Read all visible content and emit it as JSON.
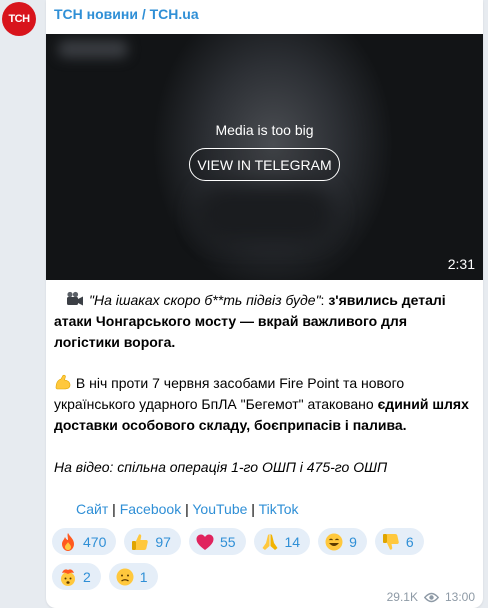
{
  "channel": {
    "avatar_text": "ТСН",
    "name": "ТСН новини / TCH.ua"
  },
  "media": {
    "note": "Media is too big",
    "button_label": "VIEW IN TELEGRAM",
    "duration": "2:31"
  },
  "post": {
    "p1_italic": "\"На ішаках скоро б**ть підвіз буде\"",
    "p1_colon": ": ",
    "p1_bold": "з'явились деталі атаки Чонгарського мосту — вкрай важливого для логістики ворога.",
    "p2_text": " В ніч проти 7 червня засобами Fire Point та нового українського ударного БпЛА \"Бегемот\" атаковано ",
    "p2_bold": "єдиний шлях доставки особового складу, боєприпасів і палива.",
    "p3_italic": "На відео: спільна операція 1-го ОШП і 475-го ОШП",
    "links": [
      "Сайт",
      "Facebook",
      "YouTube",
      "TikTok"
    ],
    "link_separator": " | "
  },
  "reactions": [
    {
      "icon": "fire-icon",
      "count": "470",
      "color": "#ff5a1f"
    },
    {
      "icon": "thumbs-up-icon",
      "count": "97",
      "color": "#ffc83d"
    },
    {
      "icon": "heart-icon",
      "count": "55",
      "color": "#e0245e"
    },
    {
      "icon": "pray-icon",
      "count": "14",
      "color": "#ffc83d"
    },
    {
      "icon": "grin-icon",
      "count": "9",
      "color": "#ffc83d"
    },
    {
      "icon": "thumbs-down-icon",
      "count": "6",
      "color": "#ffc83d"
    },
    {
      "icon": "exploding-head-icon",
      "count": "2",
      "color": "#ffc83d"
    },
    {
      "icon": "sad-face-icon",
      "count": "1",
      "color": "#ffc83d"
    }
  ],
  "footer": {
    "views": "29.1K",
    "time": "13:00"
  },
  "colors": {
    "accent": "#2f8fd6",
    "reaction_bg": "#e5eef8",
    "avatar_bg": "#d8141c"
  }
}
